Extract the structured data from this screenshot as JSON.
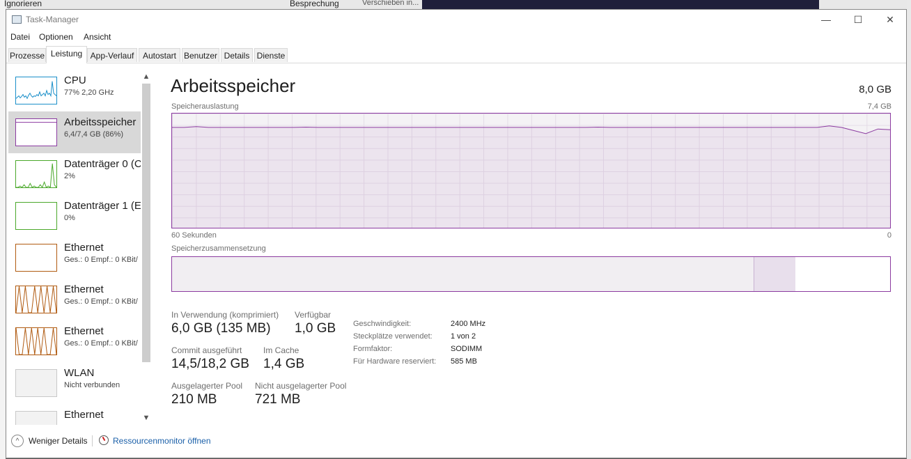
{
  "background": {
    "left_text": "Ignorieren",
    "center_text": "Besprechung",
    "partial_text": "Verschieben in..."
  },
  "window": {
    "title": "Task-Manager",
    "controls": {
      "minimize": "—",
      "maximize": "☐",
      "close": "✕"
    }
  },
  "menu": [
    "Datei",
    "Optionen",
    "Ansicht"
  ],
  "tabs": [
    "Prozesse",
    "Leistung",
    "App-Verlauf",
    "Autostart",
    "Benutzer",
    "Details",
    "Dienste"
  ],
  "active_tab": "Leistung",
  "sidebar": {
    "items": [
      {
        "name": "CPU",
        "sub": "77% 2,20 GHz",
        "color": "#1a8fc9"
      },
      {
        "name": "Arbeitsspeicher",
        "sub": "6,4/7,4 GB (86%)",
        "color": "#8b3aa0"
      },
      {
        "name": "Datenträger 0 (C",
        "sub": "2%",
        "color": "#4aa82a"
      },
      {
        "name": "Datenträger 1 (E",
        "sub": "0%",
        "color": "#4aa82a"
      },
      {
        "name": "Ethernet",
        "sub": "Ges.: 0 Empf.: 0 KBit/",
        "color": "#b05a10"
      },
      {
        "name": "Ethernet",
        "sub": "Ges.: 0 Empf.: 0 KBit/",
        "color": "#b05a10"
      },
      {
        "name": "Ethernet",
        "sub": "Ges.: 0 Empf.: 0 KBit/",
        "color": "#b05a10"
      },
      {
        "name": "WLAN",
        "sub": "Nicht verbunden",
        "color": "#c8c8c8"
      },
      {
        "name": "Ethernet",
        "sub": "",
        "color": "#c8c8c8"
      }
    ]
  },
  "main": {
    "title": "Arbeitsspeicher",
    "total": "8,0 GB",
    "usage_label": "Speicherauslastung",
    "usage_max": "7,4 GB",
    "time_label": "60 Sekunden",
    "time_min": "0",
    "composition_label": "Speicherzusammensetzung",
    "stats": {
      "in_use_label": "In Verwendung (komprimiert)",
      "in_use_value": "6,0 GB (135 MB)",
      "available_label": "Verfügbar",
      "available_value": "1,0 GB",
      "commit_label": "Commit ausgeführt",
      "commit_value": "14,5/18,2 GB",
      "cache_label": "Im Cache",
      "cache_value": "1,4 GB",
      "paged_label": "Ausgelagerter Pool",
      "paged_value": "210 MB",
      "nonpaged_label": "Nicht ausgelagerter Pool",
      "nonpaged_value": "721 MB"
    },
    "specs": [
      {
        "key": "Geschwindigkeit:",
        "value": "2400 MHz"
      },
      {
        "key": "Steckplätze verwendet:",
        "value": "1 von 2"
      },
      {
        "key": "Formfaktor:",
        "value": "SODIMM"
      },
      {
        "key": "Für Hardware reserviert:",
        "value": "585 MB"
      }
    ]
  },
  "footer": {
    "less_details": "Weniger Details",
    "resource_monitor": "Ressourcenmonitor öffnen"
  },
  "chart_data": {
    "type": "line",
    "title": "Speicherauslastung",
    "ylim": [
      0,
      7.4
    ],
    "series": [
      {
        "values": [
          6.5,
          6.5,
          6.55,
          6.5,
          6.5,
          6.5,
          6.5,
          6.5,
          6.5,
          6.5,
          6.5,
          6.52,
          6.5,
          6.5,
          6.5,
          6.5,
          6.5,
          6.5,
          6.5,
          6.5,
          6.5,
          6.5,
          6.5,
          6.5,
          6.5,
          6.5,
          6.5,
          6.5,
          6.5,
          6.5,
          6.5,
          6.5,
          6.5,
          6.5,
          6.5,
          6.52,
          6.5,
          6.5,
          6.5,
          6.5,
          6.5,
          6.5,
          6.5,
          6.5,
          6.5,
          6.5,
          6.5,
          6.5,
          6.5,
          6.5,
          6.5,
          6.5,
          6.5,
          6.5,
          6.6,
          6.5,
          6.3,
          6.1,
          6.4,
          6.35
        ]
      }
    ],
    "composition": {
      "in_use_fraction": 0.81,
      "modified_fraction": 0.058,
      "standby_fraction": 0.132
    }
  },
  "colors": {
    "memory": "#8b3aa0",
    "link": "#1a5fa8"
  }
}
